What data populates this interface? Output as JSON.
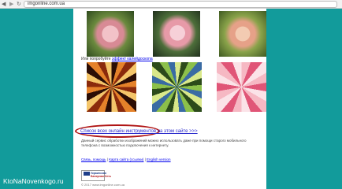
{
  "browser": {
    "url": "imgonline.com.ua",
    "back_icon": "back-arrow-icon",
    "forward_icon": "forward-arrow-icon",
    "reload_icon": "reload-icon"
  },
  "page": {
    "try_prefix": "Или попробуйте",
    "try_link": "эффект калейдоскопа",
    "all_tools_link": "Список всех онлайн инструментов на этом сайте >>>",
    "description": "Данный сервис обработки изображений можно использовать даже при помощи старого мобильного телефона с возможностью подключения к интернету.",
    "footer": {
      "link1": "Связь, помощь",
      "sep1": " | ",
      "link2": "Карта сайта (ссылки)",
      "sep2": " | ",
      "link3": "English version"
    },
    "counter": {
      "line1": "Украинская",
      "line2": "Банерная Сеть"
    },
    "copyright": "© 2017 www.imgonline.com.ua"
  },
  "watermark": "KtoNaNovenkogo.ru",
  "colors": {
    "background": "#129b9b",
    "highlight_ellipse": "#b01414",
    "link": "#0000ee"
  }
}
